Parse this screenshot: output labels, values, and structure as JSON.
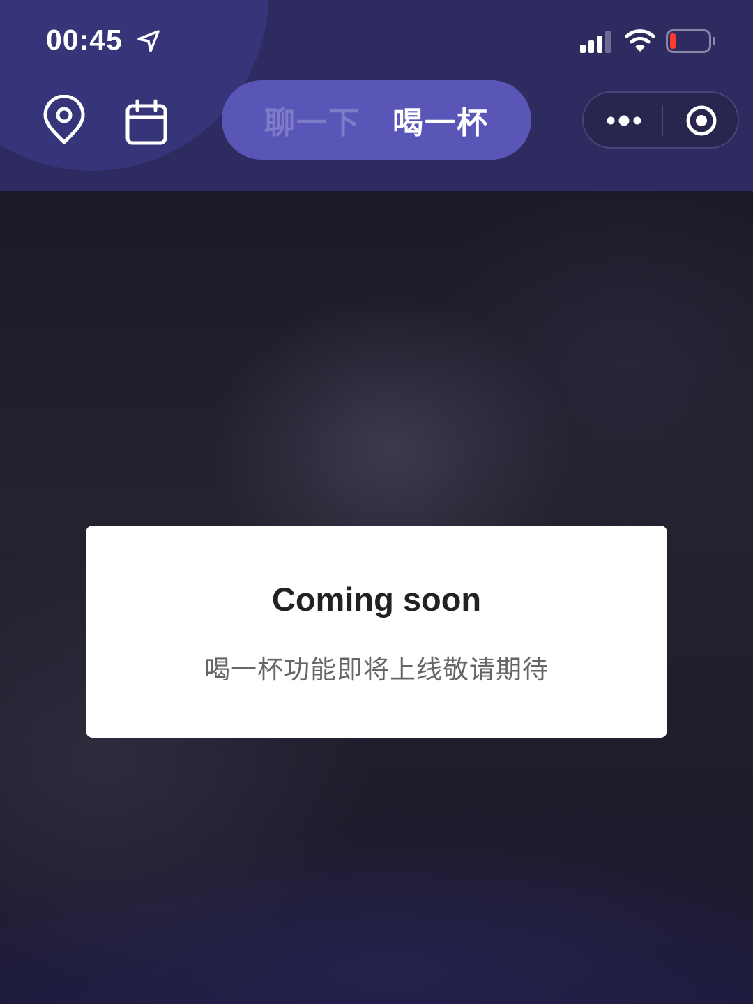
{
  "status_bar": {
    "time": "00:45",
    "icons": [
      "location-arrow-icon",
      "signal-icon",
      "wifi-icon",
      "battery-low-icon"
    ],
    "battery_color": "#ff3b30"
  },
  "nav": {
    "left_icons": [
      "map-pin-icon",
      "calendar-icon"
    ],
    "tabs": [
      {
        "label": "聊一下",
        "selected": false
      },
      {
        "label": "喝一杯",
        "selected": true
      }
    ],
    "capsule_icons": [
      "more-dots-icon",
      "target-icon"
    ]
  },
  "modal": {
    "title": "Coming soon",
    "message": "喝一杯功能即将上线敬请期待"
  },
  "colors": {
    "header_bg": "#2e2b60",
    "segment_bg": "#5a56b8",
    "modal_bg": "#ffffff"
  }
}
